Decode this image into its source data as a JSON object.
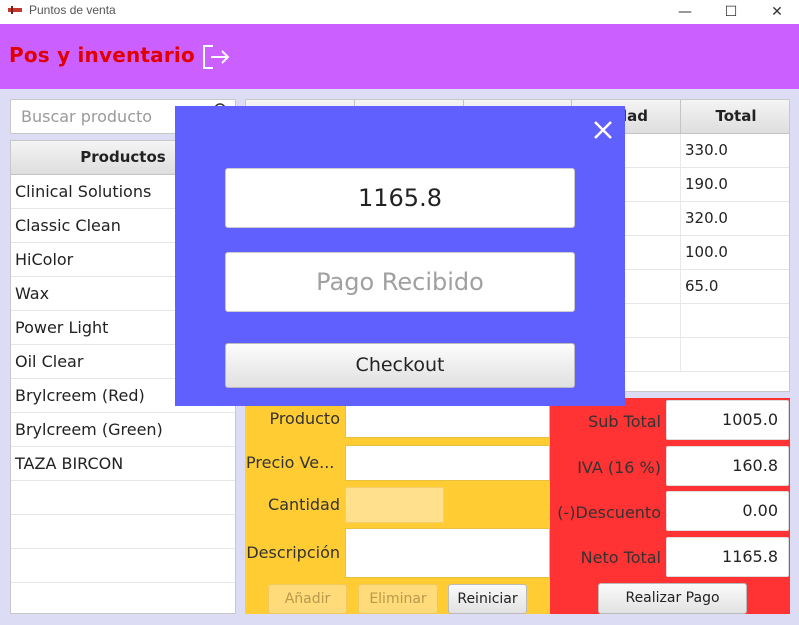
{
  "window": {
    "title": "Puntos de venta",
    "minimize": "—",
    "maximize": "☐",
    "close": "✕"
  },
  "header": {
    "title": "Pos y inventario",
    "logout_icon": "logout-icon"
  },
  "search": {
    "placeholder": "Buscar producto",
    "icon": "search-icon"
  },
  "products": {
    "header": "Productos",
    "items": [
      "Clinical Solutions",
      "Classic Clean",
      "HiColor",
      "Wax",
      "Power Light",
      "Oil Clear",
      "Brylcreem (Red)",
      "Brylcreem (Green)",
      "TAZA BIRCON"
    ]
  },
  "cart": {
    "columns": [
      "",
      "",
      "",
      "tidad",
      "Total"
    ],
    "rows": [
      [
        "",
        "",
        "",
        "",
        "330.0"
      ],
      [
        "",
        "",
        "",
        "",
        "190.0"
      ],
      [
        "",
        "",
        "",
        "",
        "320.0"
      ],
      [
        "",
        "",
        "",
        "",
        "100.0"
      ],
      [
        "",
        "",
        "",
        "",
        "65.0"
      ],
      [
        "",
        "",
        "",
        "",
        ""
      ],
      [
        "",
        "",
        "",
        "",
        ""
      ]
    ]
  },
  "form": {
    "producto_label": "Producto",
    "precio_label": "Precio Ve...",
    "cantidad_label": "Cantidad",
    "descripcion_label": "Descripción",
    "add_button": "Añadir",
    "delete_button": "Eliminar",
    "reset_button": "Reiniciar"
  },
  "totals": {
    "subtotal_label": "Sub Total",
    "subtotal_value": "1005.0",
    "iva_label": "IVA (16 %)",
    "iva_value": "160.8",
    "discount_label": "(-)Descuento",
    "discount_value": "0.00",
    "net_label": "Neto Total",
    "net_value": "1165.8",
    "pay_button": "Realizar Pago"
  },
  "modal": {
    "amount": "1165.8",
    "payment_placeholder": "Pago Recibido",
    "checkout_button": "Checkout",
    "close_icon": "close-icon"
  },
  "colors": {
    "header": "#cc5fff",
    "title_text": "#e00000",
    "form_bg": "#ffcc33",
    "totals_bg": "#ff3333",
    "modal_bg": "#6060ff"
  }
}
